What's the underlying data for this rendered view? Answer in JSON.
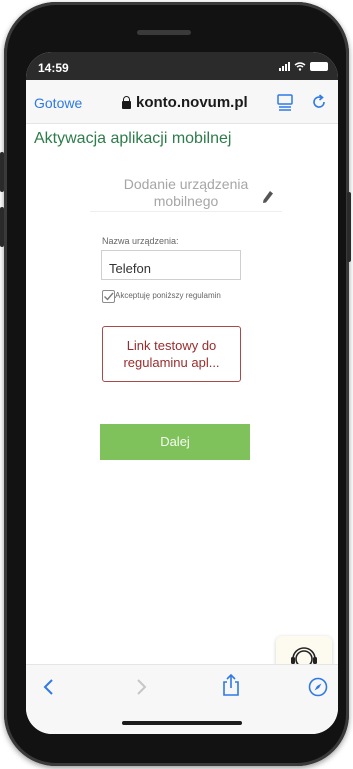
{
  "status_bar": {
    "time": "14:59"
  },
  "browser": {
    "done_label": "Gotowe",
    "address": "konto.novum.pl"
  },
  "page": {
    "title": "Aktywacja aplikacji mobilnej",
    "device_header": "Dodanie urządzenia mobilnego",
    "device_name_label": "Nazwa urządzenia:",
    "device_name_value": "Telefon",
    "terms_checkbox_label": "Akceptuję poniższy regulamin",
    "terms_checked": true,
    "terms_link": "Link testowy do regulaminu apl...",
    "next_button": "Dalej"
  },
  "colors": {
    "title_green": "#2e7c4a",
    "button_green": "#7fc15b",
    "link_red": "#9a2c2c",
    "browser_blue": "#2f7ae5"
  },
  "icons": {
    "lock": "lock-icon",
    "reader": "reader-view-icon",
    "reload": "reload-icon",
    "pencil": "pencil-icon",
    "support": "headset-support-icon",
    "back": "chevron-left-icon",
    "forward": "chevron-right-icon",
    "share": "share-icon",
    "compass": "compass-icon"
  }
}
